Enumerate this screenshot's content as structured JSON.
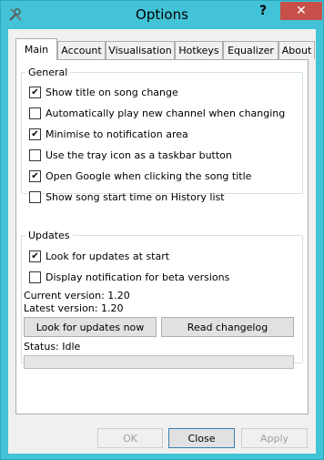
{
  "window": {
    "title": "Options",
    "help_glyph": "?",
    "close_glyph": "✕"
  },
  "tabs": [
    {
      "label": "Main",
      "active": true
    },
    {
      "label": "Account"
    },
    {
      "label": "Visualisation"
    },
    {
      "label": "Hotkeys"
    },
    {
      "label": "Equalizer"
    },
    {
      "label": "About"
    }
  ],
  "general": {
    "legend": "General",
    "options": [
      {
        "label": "Show title on song change",
        "checked": true
      },
      {
        "label": "Automatically play new channel when changing",
        "checked": false
      },
      {
        "label": "Minimise to notification area",
        "checked": true
      },
      {
        "label": "Use the tray icon as a taskbar button",
        "checked": false
      },
      {
        "label": "Open Google when clicking the song title",
        "checked": true
      },
      {
        "label": "Show song start time on History list",
        "checked": false
      }
    ]
  },
  "updates": {
    "legend": "Updates",
    "options": [
      {
        "label": "Look for updates at start",
        "checked": true
      },
      {
        "label": "Display notification for beta versions",
        "checked": false
      }
    ],
    "current_version": "Current version: 1.20",
    "latest_version": "Latest version: 1.20",
    "check_button": "Look for updates now",
    "changelog_button": "Read changelog",
    "status": "Status: Idle",
    "progress": 0
  },
  "footer": {
    "ok": "OK",
    "close": "Close",
    "apply": "Apply"
  },
  "colors": {
    "window_frame": "#42c3d7",
    "close_button": "#c7504a"
  }
}
